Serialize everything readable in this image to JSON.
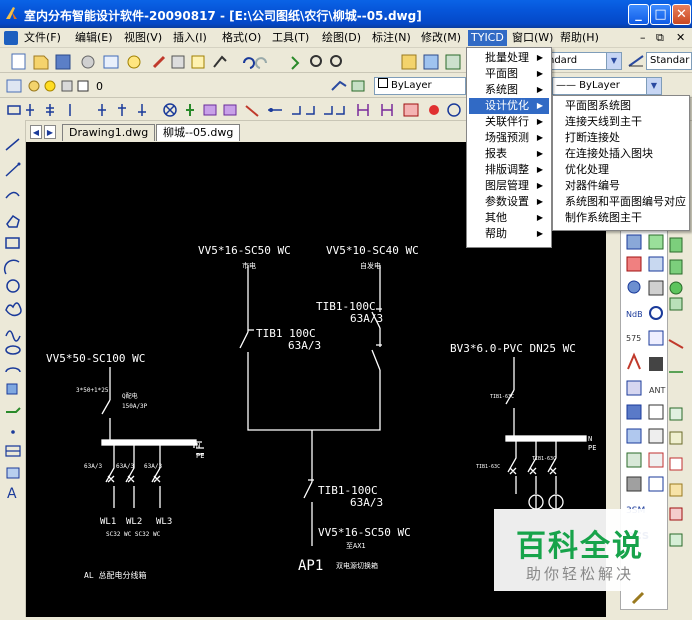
{
  "window": {
    "title": "室内分布智能设计软件-20090817 - [E:\\公司图纸\\农行\\柳城--05.dwg]",
    "minimize_label": "_",
    "maximize_label": "□",
    "close_label": "✕"
  },
  "menubar": {
    "items": [
      "文件(F)",
      "编辑(E)",
      "视图(V)",
      "插入(I)",
      "格式(O)",
      "工具(T)",
      "绘图(D)",
      "标注(N)",
      "修改(M)",
      "TYICD",
      "窗口(W)",
      "帮助(H)"
    ],
    "mdi_minimize": "–",
    "mdi_restore": "⧉",
    "mdi_close": "✕"
  },
  "toolbar": {
    "layer_combo": "0",
    "style_combo": "ndard",
    "style_combo2": "Standar",
    "color_combo": "ByLayer",
    "linetype_combo": "—— ByLayer"
  },
  "tabs": {
    "drawing1": "Drawing1.dwg",
    "drawing2": "柳城--05.dwg"
  },
  "tyicd_menu": {
    "items": [
      "批量处理",
      "平面图",
      "系统图",
      "设计优化",
      "关联伴行",
      "场强预测",
      "报表",
      "排版调整",
      "图层管理",
      "参数设置",
      "其他",
      "帮助"
    ],
    "selected": "设计优化"
  },
  "submenu": {
    "items": [
      "平面图系统图",
      "连接天线到主干",
      "打断连接处",
      "在连接处插入图块",
      "优化处理",
      "对器件编号",
      "系统图和平面图编号对应",
      "制作系统图主干"
    ]
  },
  "cad": {
    "labels": {
      "cable1": "VV5*16-SC50 WC",
      "cable1_sub": "市电",
      "cable2": "VV5*10-SC40 WC",
      "cable2_sub": "自发电",
      "breaker_top": "TIB1-100C",
      "breaker_top_rating": "63A/3",
      "breaker_left": "TIB1  100C",
      "breaker_left_rating": "63A/3",
      "breaker_bottom": "TIB1-100C",
      "breaker_bottom_rating": "63A/3",
      "cable_out": "VV5*16-SC50 WC",
      "cable_out_sub": "至AX1",
      "panel_name": "AP1",
      "panel_desc": "双电源切换箱",
      "left_cable": "VV5*50-SC100 WC",
      "left_small1": "3*50+1*25",
      "left_small2": "Q配电",
      "left_small3": "150A/3P",
      "left_n": "N",
      "left_pe": "PE",
      "left_b1": "63A/3",
      "left_b2": "63A/3",
      "left_b3": "63A/3",
      "left_wl1": "WL1",
      "left_wl2": "WL2",
      "left_wl3": "WL3",
      "left_sc": "SC32 WC SC32 WC",
      "left_caption": "AL 总配电分线箱",
      "right_cable": "BV3*6.0-PVC DN25 WC",
      "right_b1": "TIB1-63C",
      "right_b2": "TIB1-63C",
      "right_b3": "TIB1-63C",
      "right_n": "N",
      "right_pe": "PE"
    }
  },
  "watermark": {
    "title": "百科全说",
    "subtitle": "助你轻松解决"
  },
  "colors": {
    "titlebar": "#0654d8",
    "menu_highlight": "#316ac5",
    "canvas": "#000000",
    "watermark": "#17a34a"
  }
}
